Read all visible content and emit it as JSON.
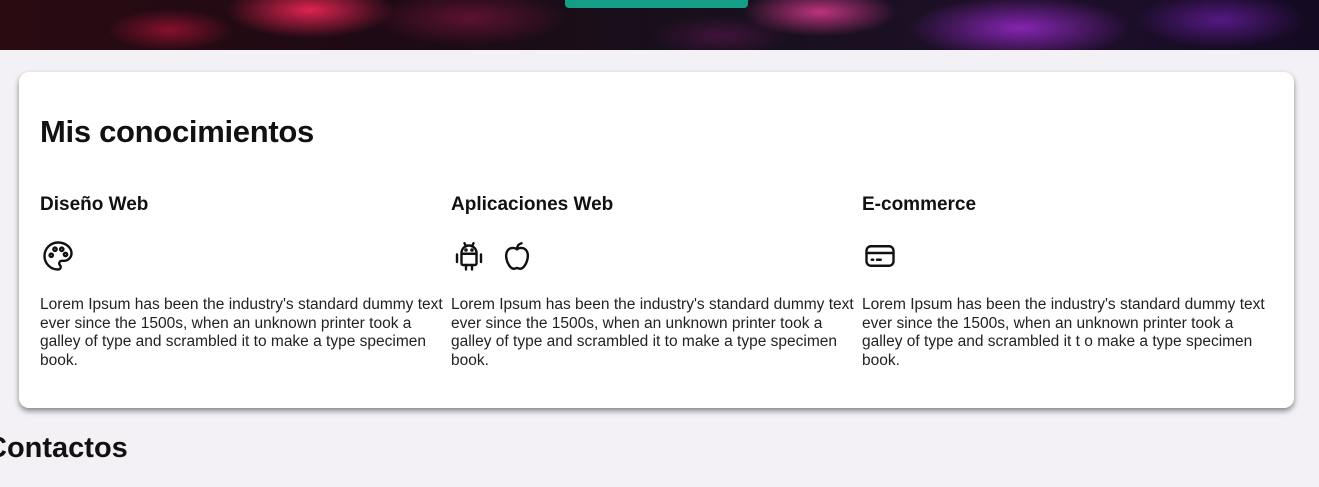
{
  "hero": {
    "button_label": ""
  },
  "skills": {
    "title": "Mis conocimientos",
    "items": [
      {
        "title": "Diseño Web",
        "icons": [
          "palette-icon"
        ],
        "text": "Lorem Ipsum has been the industry's standard dummy text ever since the 1500s, when an unknown printer took a galley of type and scrambled it to make a type specimen book."
      },
      {
        "title": "Aplicaciones Web",
        "icons": [
          "android-icon",
          "apple-icon"
        ],
        "text": "Lorem Ipsum has been the industry's standard dummy text ever since the 1500s, when an unknown printer took a galley of type and scrambled it to make a type specimen book."
      },
      {
        "title": "E-commerce",
        "icons": [
          "credit-card-icon"
        ],
        "text": "Lorem Ipsum has been the industry's standard dummy text ever since the 1500s, when an unknown printer took a galley of type and scrambled it t o make a type specimen book."
      }
    ]
  },
  "contacts": {
    "title": "Contactos"
  },
  "colors": {
    "accent": "#149e86",
    "background": "#f3f1f6"
  }
}
